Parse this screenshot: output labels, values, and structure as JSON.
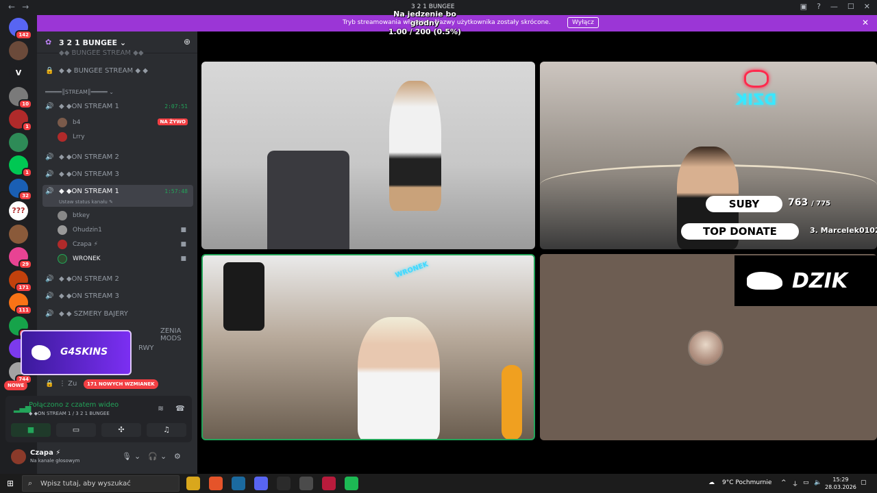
{
  "window": {
    "title": "3 2 1 BUNGEE",
    "overlay_line1": "Na jedzenie bo głodny",
    "overlay_line2": "1.00 / 200 (0.5%)",
    "nav_back": "←",
    "nav_forward": "→"
  },
  "banner": {
    "text": "Tryb streamowania włączony. Nazwy użytkownika zostały skrócone.",
    "button": "Wyłącz",
    "close": "✕"
  },
  "guilds": [
    {
      "label": "",
      "badge": "142",
      "color": "#5865f2"
    },
    {
      "label": "",
      "badge": "",
      "color": "#6b4a3a"
    },
    {
      "label": "V",
      "badge": "",
      "color": "#1e1f22"
    },
    {
      "label": "",
      "badge": "10",
      "color": "#7a7a7a"
    },
    {
      "label": "",
      "badge": "1",
      "color": "#b02a2a"
    },
    {
      "label": "",
      "badge": "",
      "color": "#2e8b57"
    },
    {
      "label": "",
      "badge": "1",
      "color": "#00c853"
    },
    {
      "label": "",
      "badge": "32",
      "color": "#1a5fb4"
    },
    {
      "label": "???",
      "badge": "",
      "color": "#ffffff"
    },
    {
      "label": "",
      "badge": "",
      "color": "#8a5a3a"
    },
    {
      "label": "",
      "badge": "29",
      "color": "#e84393"
    },
    {
      "label": "",
      "badge": "171",
      "color": "#c2410c"
    },
    {
      "label": "",
      "badge": "111",
      "color": "#f97316"
    },
    {
      "label": "",
      "badge": "14",
      "color": "#16a34a"
    },
    {
      "label": "",
      "badge": "",
      "color": "#7c3aed"
    },
    {
      "label": "",
      "badge": "744",
      "color": "#a3a3a3"
    }
  ],
  "server": {
    "name": "3 2 1 BUNGEE",
    "name_suffix": "⌄",
    "invite_icon": "person-add-icon"
  },
  "channels": {
    "bungee_stream_top": "◆◆ BUNGEE STREAM ◆◆",
    "bungee_stream": "◆ ◆ BUNGEE STREAM ◆ ◆",
    "stream_divider": "═════║STREAM║═════ ⌄",
    "on_stream_1_a": "◆ ◆ON STREAM 1",
    "on_stream_1_a_time": "2:07:51",
    "user_b4": "b4",
    "user_b4_live": "NA ŻYWO",
    "user_lrry": "Lrry",
    "on_stream_2_a": "◆ ◆ON STREAM 2",
    "on_stream_3_a": "◆ ◆ON STREAM 3",
    "on_stream_1_b": "◆ ◆ON STREAM 1",
    "on_stream_1_b_time": "1:57:48",
    "on_stream_1_b_status": "Ustaw status kanału ✎",
    "user_btkey": "btkey",
    "user_ohudzin": "Ohudzin1",
    "user_czapa": "Czapa ⚡",
    "user_wronek": "WRONEK",
    "on_stream_2_b": "◆ ◆ON STREAM 2",
    "on_stream_3_b": "◆ ◆ON STREAM 3",
    "szmery": "◆ ◆ SZMERY BAJERY",
    "zenia_mods": "ZENIA MODS",
    "rwy": "RWY",
    "zu": "⋮ Zu"
  },
  "promo": {
    "text": "G4SKINS"
  },
  "mentions": "171 NOWYCH WZMIANEK",
  "nowe": "NOWE",
  "voice": {
    "status": "Połączono z czatem wideo",
    "sub": "◆ ◆ON STREAM 1 / 3 2 1 BUNGEE",
    "signal_icon": "signal-icon"
  },
  "user_panel": {
    "name": "Czapa ⚡",
    "status": "Na kanale głosowym"
  },
  "stream_overlay": {
    "suby_label": "SUBY",
    "suby_count": "763",
    "suby_total": "/ 775",
    "top_donate_label": "TOP DONATE",
    "top_donate_name": "3. Marcelek0102",
    "dzik_logo": "DZIK",
    "neon_sign": "DZIK",
    "wronek_neon": "WRONEK"
  },
  "taskbar": {
    "search_placeholder": "Wpisz tutaj, aby wyszukać",
    "weather": "9°C  Pochmurnie",
    "time": "15:29",
    "date": "28.03.2026",
    "app_colors": [
      "#d9a71c",
      "#e5542a",
      "#1b6a9f",
      "#5865f2",
      "#2b2b2b",
      "#4b4b4b",
      "#b81b3c",
      "#1db954"
    ]
  },
  "colors": {
    "accent": "#9b36d6",
    "online": "#23a55a",
    "danger": "#f23f43"
  }
}
